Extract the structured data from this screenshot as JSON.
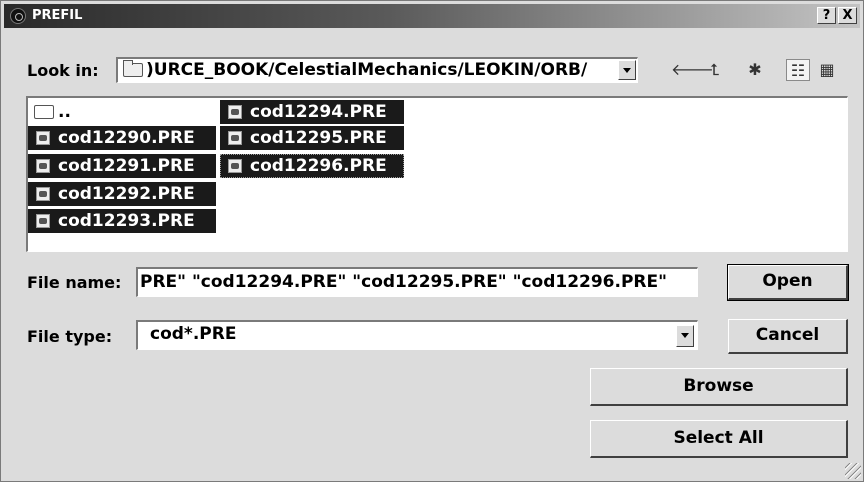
{
  "window": {
    "title": "PREFIL",
    "help_label": "?",
    "close_label": "X"
  },
  "lookin": {
    "label": "Look in:",
    "path": ")URCE_BOOK/CelestialMechanics/LEOKIN/ORB/"
  },
  "toolbar": {
    "icons": [
      "back-arrow-icon",
      "up-folder-icon",
      "new-folder-icon",
      "list-view-icon",
      "details-view-icon"
    ]
  },
  "files": {
    "up": "..",
    "items": [
      "cod12290.PRE",
      "cod12291.PRE",
      "cod12292.PRE",
      "cod12293.PRE",
      "cod12294.PRE",
      "cod12295.PRE",
      "cod12296.PRE"
    ]
  },
  "filename": {
    "label": "File name:",
    "value": "PRE\" \"cod12294.PRE\" \"cod12295.PRE\" \"cod12296.PRE\""
  },
  "filetype": {
    "label": "File type:",
    "value": "cod*.PRE"
  },
  "buttons": {
    "open": "Open",
    "cancel": "Cancel",
    "browse": "Browse",
    "select_all": "Select All"
  }
}
